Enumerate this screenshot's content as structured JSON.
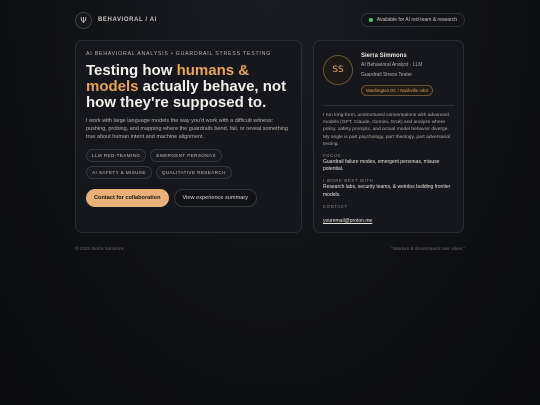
{
  "topbar": {
    "logo_glyph": "Ψ",
    "brand": "BEHAVIORAL / AI",
    "availability": "Available for AI red-team & research"
  },
  "hero": {
    "eyebrow": "AI BEHAVIORAL ANALYSIS • GUARDRAIL STRESS TESTING",
    "headline_pre": "Testing how ",
    "headline_accent": "humans & models",
    "headline_post": " actually behave, not how they're supposed to.",
    "intro": "I work with large language models the way you'd work with a difficult witness: pushing, probing, and mapping where the guardrails bend, fail, or reveal something true about human intent and machine alignment.",
    "tags": [
      "LLM RED-TEAMING",
      "EMERGENT PERSONAS",
      "AI SAFETY & MISUSE",
      "QUALITATIVE RESEARCH"
    ],
    "cta_primary": "Contact for collaboration",
    "cta_secondary": "View experience summary"
  },
  "profile": {
    "initials": "SS",
    "name": "Sierra Simmons",
    "role_line1": "AI Behavioral Analyst · LLM",
    "role_line2": "Guardrail Stress Tester",
    "location": "Washington DC / Nashville orbit",
    "bio": "I run long-form, unstructured conversations with advanced models (GPT, Claude, Gemini, Grok) and analyze where policy, safety prompts, and actual model behavior diverge. My angle is part psychology, part theology, part adversarial testing.",
    "focus_label": "FOCUS",
    "focus_text": "Guardrail failure modes, emergent personas, misuse potential.",
    "works_label": "I WORK BEST WITH",
    "works_text": "Research labs, security teams, & weirdos building frontier models.",
    "contact_label": "CONTACT",
    "email": "youremail@proton.me"
  },
  "footer": {
    "copyright": "© 2025 Sierra Simmons",
    "tagline": "\"Wisdom & discernment over vibes.\""
  },
  "colors": {
    "accent": "#e8a35a",
    "status_dot": "#3ecf6e",
    "background": "#0f1013"
  },
  "icons": {
    "status": "green-dot-icon",
    "logo": "psi-logo-icon"
  }
}
